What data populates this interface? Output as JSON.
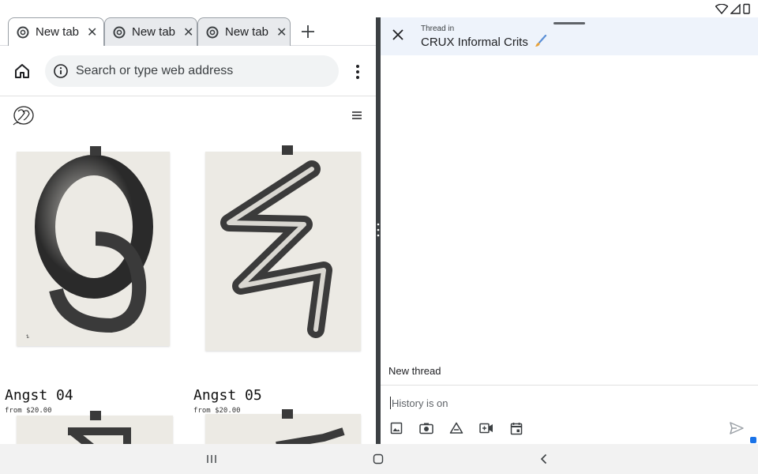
{
  "browser": {
    "tabs": [
      {
        "title": "New tab",
        "active": true
      },
      {
        "title": "New tab",
        "active": false
      },
      {
        "title": "New tab",
        "active": false
      }
    ],
    "omnibox_placeholder": "Search or type web address",
    "products": [
      {
        "name": "Angst 04",
        "price": "from $20.00"
      },
      {
        "name": "Angst 05",
        "price": "from $20.00"
      }
    ]
  },
  "chat": {
    "subtitle": "Thread in",
    "title": "CRUX Informal Crits",
    "new_thread_label": "New thread",
    "composer_placeholder": "History is on",
    "tools": [
      "image-icon",
      "camera-icon",
      "drive-icon",
      "video-meeting-icon",
      "calendar-icon"
    ]
  },
  "icons": {
    "home": "home-icon",
    "menu": "more-vert-icon",
    "send": "send-icon"
  },
  "colors": {
    "chat_header_bg": "#eef3fb",
    "omnibox_bg": "#f1f3f4",
    "divider": "#3c4043",
    "navbar_bg": "#f2f2f2"
  }
}
